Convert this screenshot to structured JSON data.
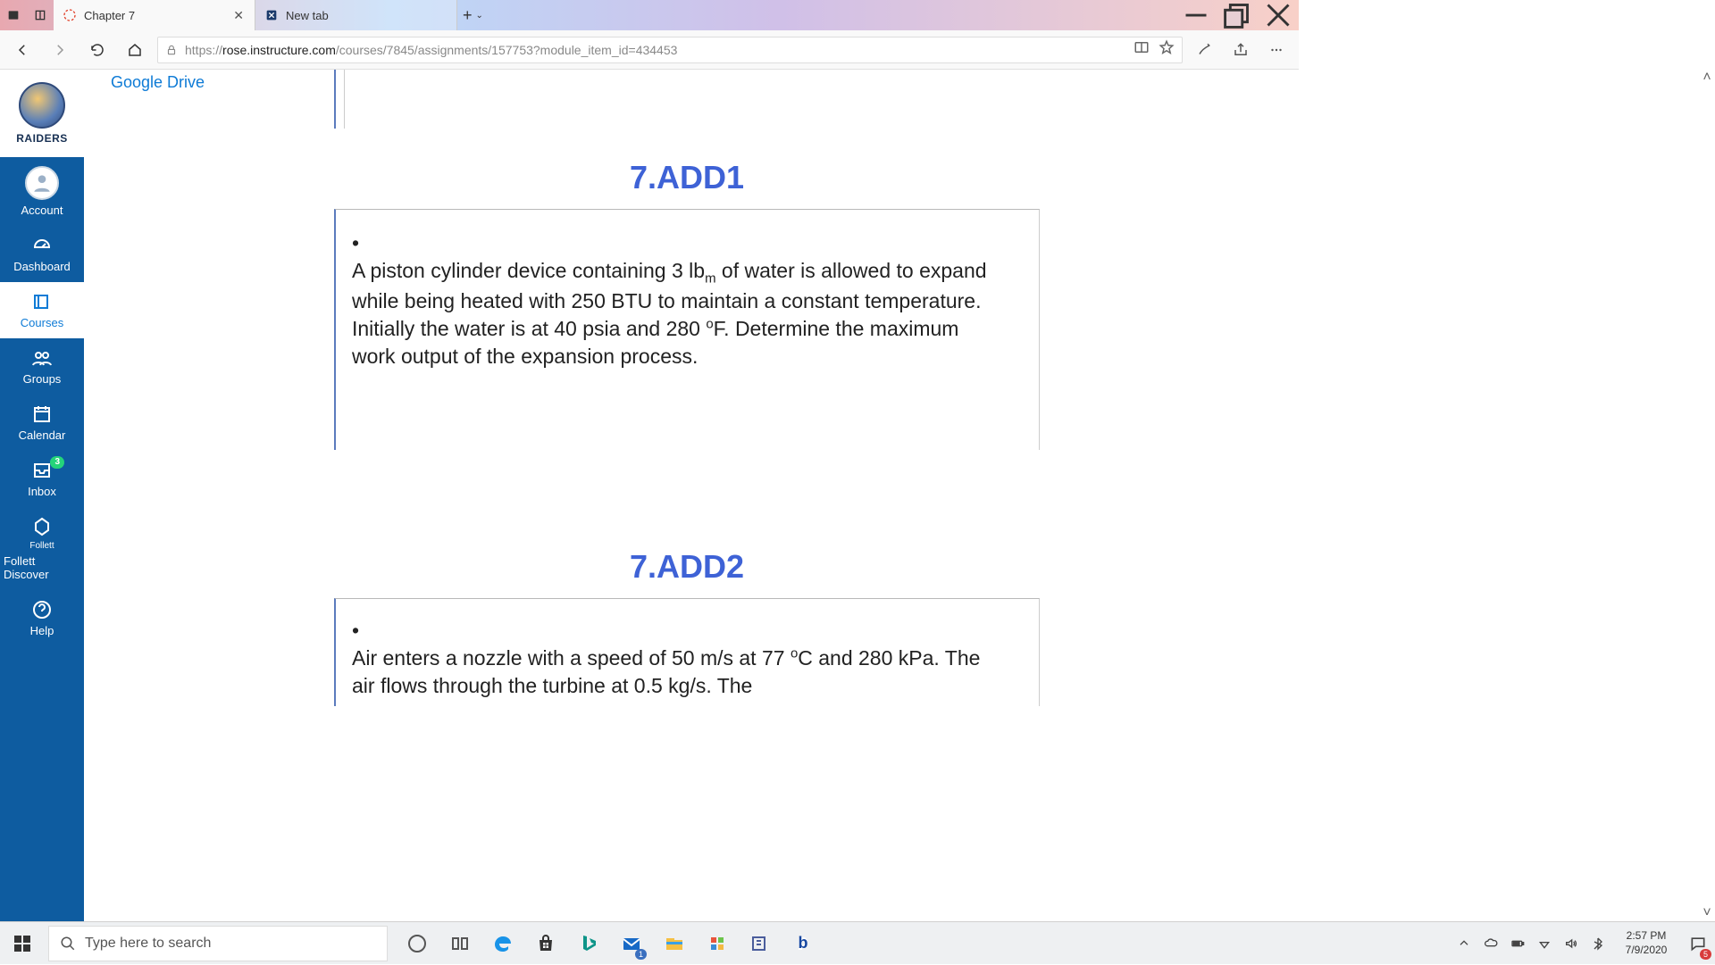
{
  "browser": {
    "tabs": [
      {
        "title": "Chapter 7",
        "active": true
      },
      {
        "title": "New tab",
        "active": false
      }
    ],
    "url_plain": "https://",
    "url_host": "rose.instructure.com",
    "url_path": "/courses/7845/assignments/157753?module_item_id=434453"
  },
  "page": {
    "link_top": "Google Drive"
  },
  "canvas_nav": {
    "brand": "RAIDERS",
    "items": [
      {
        "label": "Account"
      },
      {
        "label": "Dashboard"
      },
      {
        "label": "Courses"
      },
      {
        "label": "Groups"
      },
      {
        "label": "Calendar"
      },
      {
        "label": "Inbox",
        "badge": "3"
      },
      {
        "label": "Follett Discover",
        "sub": "Follett"
      },
      {
        "label": "Help"
      }
    ]
  },
  "problems": [
    {
      "title": "7.ADD1",
      "text": "A piston cylinder device containing 3 lbₘ of water is allowed to expand while being heated with 250 BTU to maintain a constant temperature. Initially the water is at 40 psia and 280 °F. Determine the maximum work output of the expansion process."
    },
    {
      "title": "7.ADD2",
      "text": "Air enters a nozzle with a speed of 50 m/s at 77 °C and 280 kPa. The air flows through the turbine at 0.5 kg/s. The"
    }
  ],
  "chart_data": {
    "type": "table",
    "title": "Thermodynamics problems",
    "rows": [
      {
        "id": "7.ADD1",
        "substance": "water",
        "mass_lbm": 3,
        "heat_BTU": 250,
        "P_psia": 40,
        "T_F": 280,
        "goal": "maximum work output of expansion"
      },
      {
        "id": "7.ADD2",
        "substance": "air",
        "device": "nozzle",
        "inlet_velocity_m_s": 50,
        "T_C": 77,
        "P_kPa": 280,
        "mass_flow_kg_s": 0.5
      }
    ]
  },
  "taskbar": {
    "search_placeholder": "Type here to search",
    "time": "2:57 PM",
    "date": "7/9/2020",
    "notif_count": "5",
    "mail_count": "1"
  }
}
